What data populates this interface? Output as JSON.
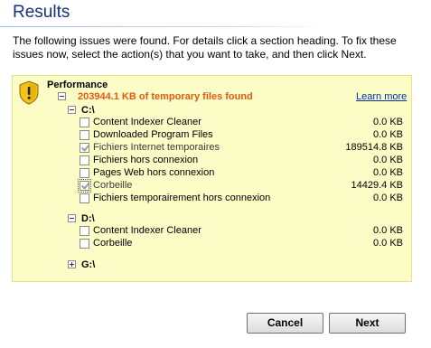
{
  "title": "Results",
  "intro": "The following issues were found. For details click a section heading. To fix these issues now, select the action(s) that you want to take, and then click Next.",
  "panel": {
    "icon": "warning-shield-icon",
    "category": "Performance",
    "summary": "203944.1 KB of temporary files found",
    "learn_more": "Learn more",
    "drives": [
      {
        "label": "C:\\",
        "expanded": true,
        "items": [
          {
            "label": "Content Indexer Cleaner",
            "size": "0.0 KB",
            "checked": false
          },
          {
            "label": "Downloaded Program Files",
            "size": "0.0 KB",
            "checked": false
          },
          {
            "label": "Fichiers Internet temporaires",
            "size": "189514.8 KB",
            "checked": true
          },
          {
            "label": "Fichiers hors connexion",
            "size": "0.0 KB",
            "checked": false
          },
          {
            "label": "Pages Web hors connexion",
            "size": "0.0 KB",
            "checked": false
          },
          {
            "label": "Corbeille",
            "size": "14429.4 KB",
            "checked": true
          },
          {
            "label": "Fichiers temporairement hors connexion",
            "size": "0.0 KB",
            "checked": false
          }
        ]
      },
      {
        "label": "D:\\",
        "expanded": true,
        "items": [
          {
            "label": "Content Indexer Cleaner",
            "size": "0.0 KB",
            "checked": false
          },
          {
            "label": "Corbeille",
            "size": "0.0 KB",
            "checked": false
          }
        ]
      },
      {
        "label": "G:\\",
        "expanded": false,
        "items": []
      }
    ]
  },
  "buttons": {
    "cancel": "Cancel",
    "next": "Next"
  },
  "colors": {
    "title": "#15317e",
    "summary": "#e15a14",
    "panel_bg": "#fcfcc7",
    "link": "#0033aa"
  }
}
